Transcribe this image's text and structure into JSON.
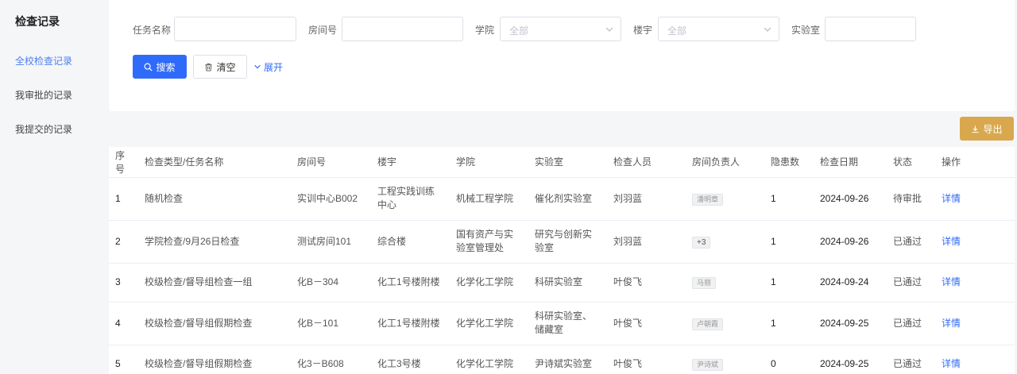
{
  "sidebar": {
    "title": "检查记录",
    "items": [
      {
        "label": "全校检查记录",
        "active": true
      },
      {
        "label": "我审批的记录",
        "active": false
      },
      {
        "label": "我提交的记录",
        "active": false
      }
    ]
  },
  "filters": {
    "task_name_label": "任务名称",
    "room_label": "房间号",
    "college_label": "学院",
    "college_placeholder": "全部",
    "building_label": "楼宇",
    "building_placeholder": "全部",
    "lab_label": "实验室"
  },
  "actions": {
    "search": "搜索",
    "clear": "清空",
    "expand": "展开",
    "export": "导出"
  },
  "colors": {
    "primary": "#2f6bfa",
    "export": "#d9a84e",
    "sidebar_active": "#4d80f0"
  },
  "table": {
    "headers": [
      "序号",
      "检查类型/任务名称",
      "房间号",
      "楼宇",
      "学院",
      "实验室",
      "检查人员",
      "房间负责人",
      "隐患数",
      "检查日期",
      "状态",
      "操作"
    ],
    "rows": [
      {
        "no": "1",
        "task": "随机检查",
        "room": "实训中心B002",
        "building": "工程实践训练中心",
        "college": "机械工程学院",
        "lab": "催化剂实验室",
        "inspector": "刘羽蓝",
        "owner": "潘明章",
        "hazards": "1",
        "date": "2024-09-26",
        "status": "待审批",
        "op": "详情"
      },
      {
        "no": "2",
        "task": "学院检查/9月26日检查",
        "room": "测试房间101",
        "building": "综合楼",
        "college": "国有资产与实验室管理处",
        "lab": "研究与创新实验室",
        "inspector": "刘羽蓝",
        "owner": "+3",
        "hazards": "1",
        "date": "2024-09-26",
        "status": "已通过",
        "op": "详情"
      },
      {
        "no": "3",
        "task": "校级检查/督导组检查一组",
        "room": "化B－304",
        "building": "化工1号楼附楼",
        "college": "化学化工学院",
        "lab": "科研实验室",
        "inspector": "叶俊飞",
        "owner": "马丽",
        "hazards": "1",
        "date": "2024-09-24",
        "status": "已通过",
        "op": "详情"
      },
      {
        "no": "4",
        "task": "校级检查/督导组假期检查",
        "room": "化B－101",
        "building": "化工1号楼附楼",
        "college": "化学化工学院",
        "lab": "科研实验室、储藏室",
        "inspector": "叶俊飞",
        "owner": "卢朝霞",
        "hazards": "1",
        "date": "2024-09-25",
        "status": "已通过",
        "op": "详情"
      },
      {
        "no": "5",
        "task": "校级检查/督导组假期检查",
        "room": "化3－B608",
        "building": "化工3号楼",
        "college": "化学化工学院",
        "lab": "尹诗斌实验室",
        "inspector": "叶俊飞",
        "owner": "尹诗斌",
        "hazards": "0",
        "date": "2024-09-25",
        "status": "已通过",
        "op": "详情"
      }
    ]
  }
}
